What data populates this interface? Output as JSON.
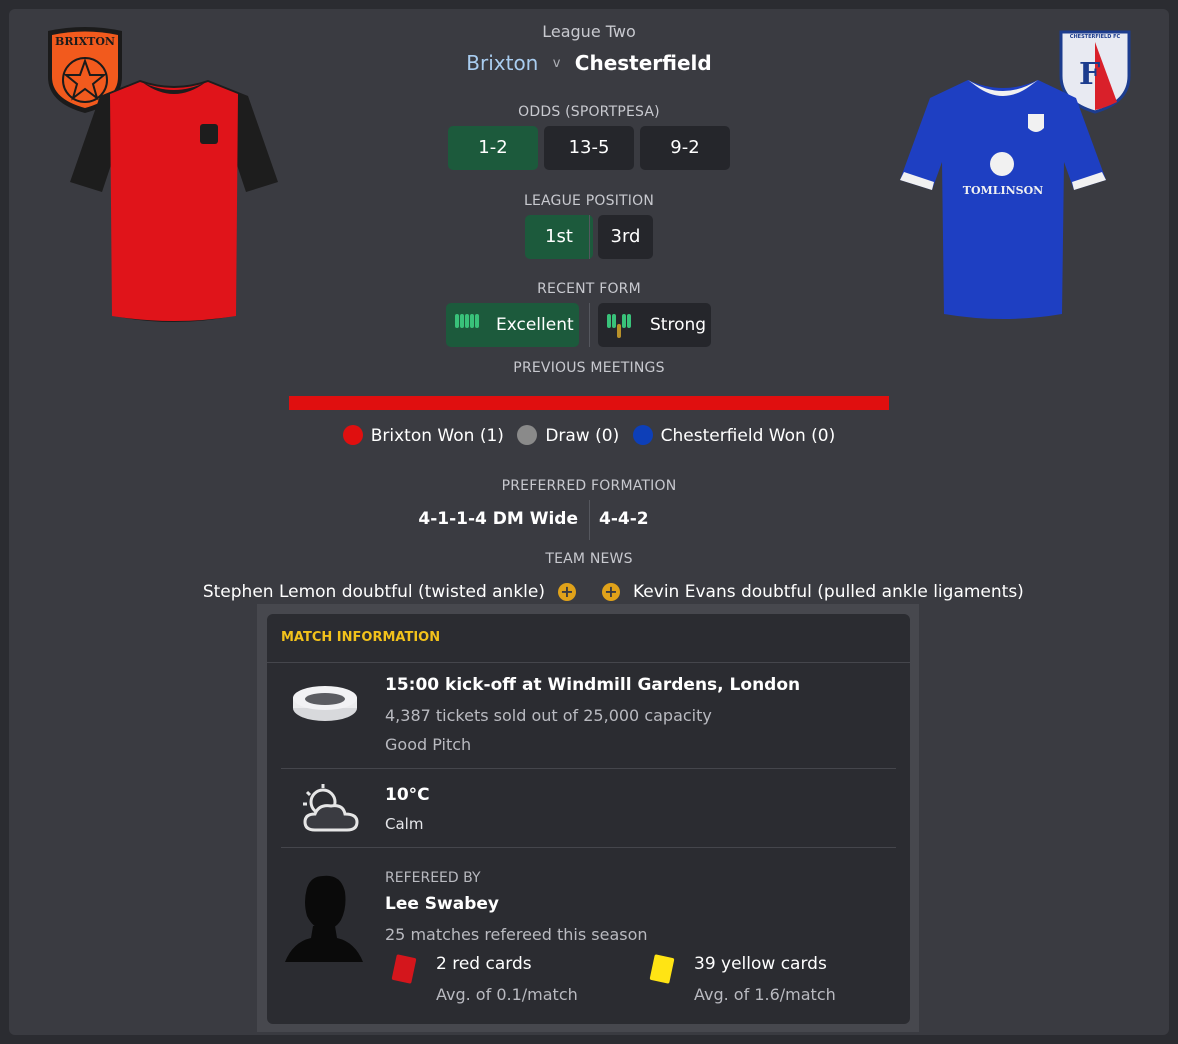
{
  "match": {
    "competition": "League Two",
    "home_team": "Brixton",
    "separator": "v",
    "away_team": "Chesterfield"
  },
  "badges": {
    "home_text": "BRIXTON",
    "away_text": "CHESTERFIELD FC",
    "away_sponsor": "TOMLINSON"
  },
  "odds": {
    "label": "ODDS (SPORTPESA)",
    "home": "1-2",
    "draw": "13-5",
    "away": "9-2"
  },
  "league_position": {
    "label": "LEAGUE POSITION",
    "home": "1st",
    "away": "3rd"
  },
  "recent_form": {
    "label": "RECENT FORM",
    "home": "Excellent",
    "away": "Strong"
  },
  "previous_meetings": {
    "label": "PREVIOUS MEETINGS",
    "home_won": "Brixton Won (1)",
    "draw": "Draw (0)",
    "away_won": "Chesterfield Won (0)",
    "home_share": 1.0
  },
  "preferred_formation": {
    "label": "PREFERRED FORMATION",
    "home": "4-1-1-4 DM Wide",
    "away": "4-4-2"
  },
  "team_news": {
    "label": "TEAM NEWS",
    "home": "Stephen Lemon doubtful (twisted ankle)",
    "away": "Kevin Evans doubtful (pulled ankle ligaments)"
  },
  "match_information": {
    "title": "MATCH INFORMATION",
    "venue": {
      "kickoff": "15:00 kick-off at Windmill Gardens, London",
      "tickets": "4,387 tickets sold out of 25,000 capacity",
      "pitch": "Good Pitch"
    },
    "weather": {
      "temperature": "10°C",
      "condition": "Calm"
    },
    "referee": {
      "label": "REFEREED BY",
      "name": "Lee Swabey",
      "matches": "25 matches refereed this season",
      "red_cards": "2 red cards",
      "red_avg": "Avg. of 0.1/match",
      "yellow_cards": "39 yellow cards",
      "yellow_avg": "Avg. of 1.6/match"
    }
  },
  "colors": {
    "home": "#e00f0f",
    "draw": "#8a8a8a",
    "away": "#0d3fb8",
    "accent_green": "#1c5a3c",
    "section_title": "#f2c21b"
  }
}
